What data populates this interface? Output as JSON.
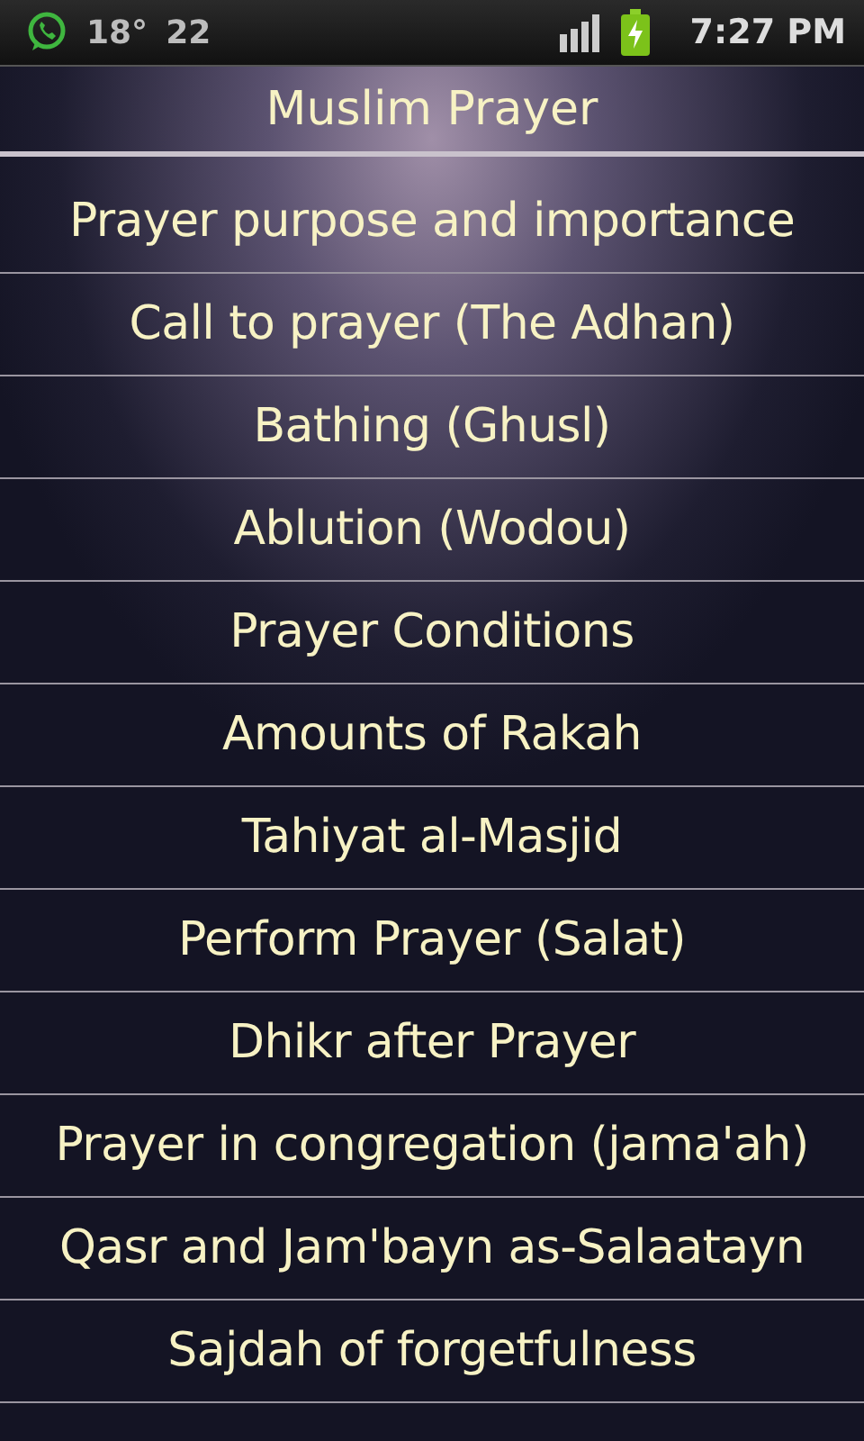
{
  "status_bar": {
    "temperature": "18°",
    "count": "22",
    "time": "7:27 PM"
  },
  "title": "Muslim Prayer",
  "items": [
    {
      "label": "Prayer purpose and importance"
    },
    {
      "label": "Call to prayer (The Adhan)"
    },
    {
      "label": "Bathing (Ghusl)"
    },
    {
      "label": "Ablution (Wodou)"
    },
    {
      "label": "Prayer Conditions"
    },
    {
      "label": "Amounts of Rakah"
    },
    {
      "label": "Tahiyat al-Masjid"
    },
    {
      "label": "Perform Prayer (Salat)"
    },
    {
      "label": "Dhikr after Prayer"
    },
    {
      "label": "Prayer in congregation (jama'ah)"
    },
    {
      "label": "Qasr and Jam'bayn as-Salaatayn"
    },
    {
      "label": "Sajdah of forgetfulness"
    }
  ]
}
